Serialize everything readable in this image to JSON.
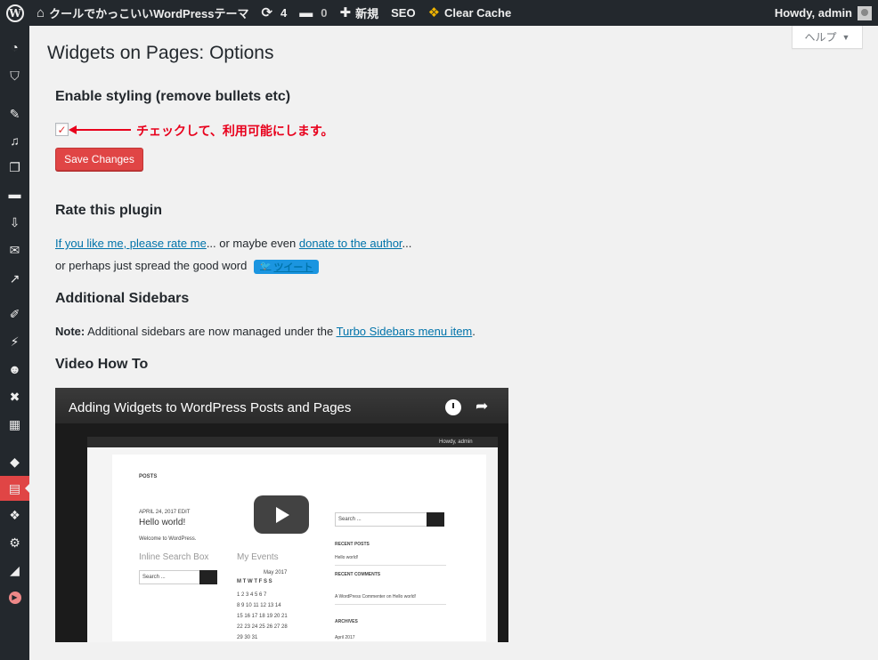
{
  "admin_bar": {
    "site_name": "クールでかっこいいWordPressテーマ",
    "updates_count": "4",
    "comments_count": "0",
    "new_label": "新規",
    "seo_label": "SEO",
    "clear_cache_label": "Clear Cache",
    "howdy": "Howdy, admin"
  },
  "help_tab": {
    "label": "ヘルプ",
    "chevron": "▼"
  },
  "page": {
    "title": "Widgets on Pages: Options",
    "enable_styling": {
      "heading": "Enable styling (remove bullets etc)",
      "checked": true,
      "check_glyph": "✓",
      "annotation": "チェックして、利用可能にします。"
    },
    "save_button": "Save Changes",
    "rate": {
      "heading": "Rate this plugin",
      "link_rate": "If you like me, please rate me",
      "text_mid": "... or maybe even ",
      "link_donate": "donate to the author",
      "text_end": "...",
      "spread_text": "or perhaps just spread the good word",
      "tweet_label": "ツイート",
      "tweet_bird": "🐦"
    },
    "sidebars": {
      "heading": "Additional Sidebars",
      "note_label": "Note:",
      "note_text": " Additional sidebars are now managed under the ",
      "note_link": "Turbo Sidebars menu item",
      "note_end": "."
    },
    "video": {
      "heading": "Video How To",
      "title": "Adding Widgets to WordPress Posts and Pages",
      "share_glyph": "➦",
      "inner": {
        "posts_label": "POSTS",
        "post_date": "APRIL 24, 2017  EDIT",
        "post_title": "Hello world!",
        "post_body": "Welcome to WordPress.",
        "inline_search": "Inline Search Box",
        "my_events": "My Events",
        "search_placeholder": "Search ...",
        "month": "May 2017",
        "weekdays": "M  T  W  T  F  S  S",
        "cal_rows": [
          "1   2   3   4   5   6   7",
          "8   9  10  11  12  13  14",
          "15  16  17  18  19  20  21",
          "22  23  24  25  26  27  28",
          "29  30  31"
        ],
        "recent_posts": "RECENT POSTS",
        "recent_post_item": "Hello world!",
        "recent_comments": "RECENT COMMENTS",
        "recent_comment_item": "A WordPress Commenter on Hello world!",
        "archives": "ARCHIVES",
        "archive_item": "April 2017",
        "howdy": "Howdy, admin"
      }
    }
  },
  "sidebar_icons": [
    "dashboard-icon",
    "shield-icon",
    "posts-pin-icon",
    "media-icon",
    "pages-icon",
    "comments-icon",
    "feedback-icon",
    "mail-icon",
    "analytics-icon",
    "appearance-icon",
    "plugins-icon",
    "users-icon",
    "tools-icon",
    "settings-widgets-icon",
    "plugin-bird-icon",
    "widgets-on-pages-icon",
    "cache-tiger-icon",
    "gear-icon",
    "stats-icon",
    "video-play-icon"
  ]
}
